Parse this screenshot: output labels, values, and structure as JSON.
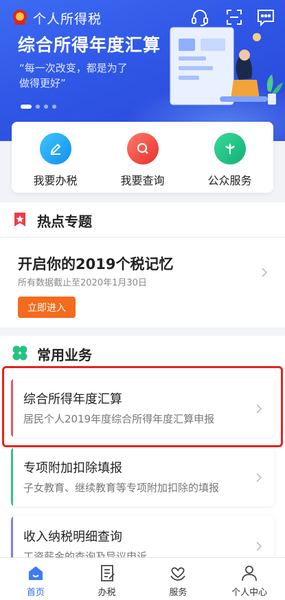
{
  "app": {
    "title": "个人所得税"
  },
  "banner": {
    "title": "综合所得年度汇算",
    "subtitle_line1": "“每一次改变，都是为了",
    "subtitle_line2": "做得更好”",
    "slide_count": 4,
    "active_slide": 1
  },
  "topbar": {
    "icons": [
      "headset-icon",
      "scan-icon",
      "message-icon"
    ]
  },
  "quick_actions": [
    {
      "label": "我要办税",
      "icon": "pencil-icon",
      "color": "#19a7f2"
    },
    {
      "label": "我要查询",
      "icon": "search-icon",
      "color": "#f0473f"
    },
    {
      "label": "公众服务",
      "icon": "flower-icon",
      "color": "#1dbf86"
    }
  ],
  "hot_section": {
    "title": "热点专题",
    "card_title": "开启你的2019个税记忆",
    "card_sub": "所有数据截止至2020年1月30日",
    "button": "立即进入"
  },
  "common_section": {
    "title": "常用业务",
    "items": [
      {
        "title": "综合所得年度汇算",
        "desc": "居民个人2019年度综合所得年度汇算申报",
        "accent": "#e25a6a"
      },
      {
        "title": "专项附加扣除填报",
        "desc": "子女教育、继续教育等专项附加扣除的填报",
        "accent": "#33c27f"
      },
      {
        "title": "收入纳税明细查询",
        "desc": "工资薪金的查询及异议申诉",
        "accent": "#7e7fe0"
      }
    ]
  },
  "bottom_nav": [
    {
      "label": "首页",
      "icon": "home-icon",
      "active": true
    },
    {
      "label": "办税",
      "icon": "document-icon",
      "active": false
    },
    {
      "label": "服务",
      "icon": "heart-hands-icon",
      "active": false
    },
    {
      "label": "个人中心",
      "icon": "person-icon",
      "active": false
    }
  ],
  "colors": {
    "brand": "#2f56e6",
    "active_nav": "#2f6bf2",
    "button": "#f46b1d",
    "highlight": "#e8221b"
  }
}
